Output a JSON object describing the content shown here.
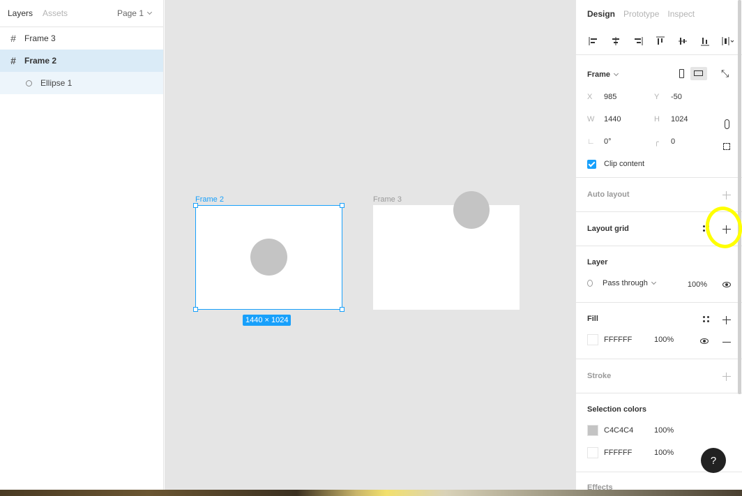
{
  "left_panel": {
    "tabs": [
      "Layers",
      "Assets"
    ],
    "page_selector": "Page 1",
    "layers": [
      {
        "name": "Frame 3"
      },
      {
        "name": "Frame 2"
      },
      {
        "name": "Ellipse 1"
      }
    ]
  },
  "canvas": {
    "frame2_label": "Frame 2",
    "frame3_label": "Frame 3",
    "dimensions_badge": "1440 × 1024"
  },
  "right_panel": {
    "tabs": [
      "Design",
      "Prototype",
      "Inspect"
    ],
    "frame": {
      "title": "Frame",
      "x_label": "X",
      "x_value": "985",
      "y_label": "Y",
      "y_value": "-50",
      "w_label": "W",
      "w_value": "1440",
      "h_label": "H",
      "h_value": "1024",
      "rotation": "0°",
      "radius": "0",
      "clip_label": "Clip content"
    },
    "auto_layout": "Auto layout",
    "layout_grid": "Layout grid",
    "layer": {
      "title": "Layer",
      "blend": "Pass through",
      "opacity": "100%"
    },
    "fill": {
      "title": "Fill",
      "hex": "FFFFFF",
      "opacity": "100%"
    },
    "stroke": "Stroke",
    "selection_colors": {
      "title": "Selection colors",
      "colors": [
        {
          "hex": "C4C4C4",
          "opacity": "100%",
          "swatch": "#c4c4c4"
        },
        {
          "hex": "FFFFFF",
          "opacity": "100%",
          "swatch": "#ffffff"
        }
      ]
    },
    "effects": "Effects"
  },
  "help_label": "?",
  "colors": {
    "accent": "#18a0fb",
    "selected_row": "#daebf7",
    "canvas_bg": "#e5e5e5",
    "highlight": "#ffff00"
  }
}
